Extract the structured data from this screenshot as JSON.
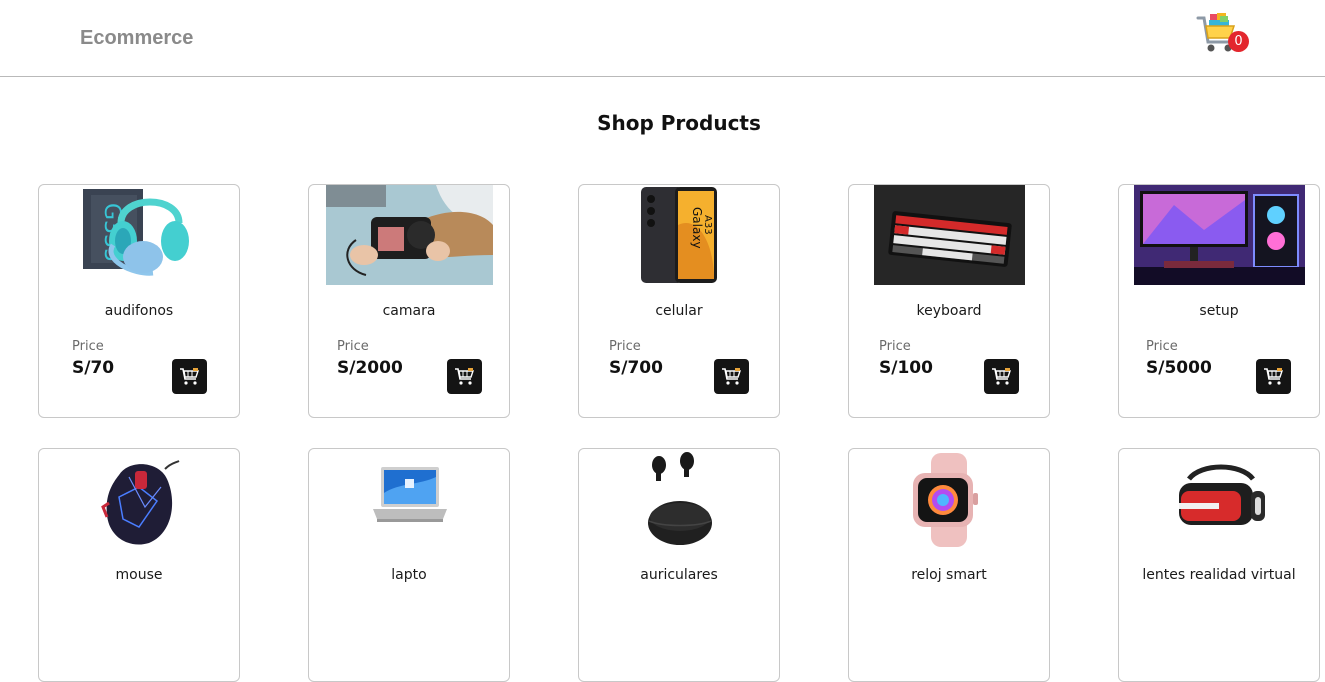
{
  "header": {
    "brand": "Ecommerce",
    "cart_count": "0",
    "cart_icon": "shopping-cart-icon"
  },
  "page_title": "Shop Products",
  "price_label": "Price",
  "products": [
    {
      "name": "audifonos",
      "price": "S/70"
    },
    {
      "name": "camara",
      "price": "S/2000"
    },
    {
      "name": "celular",
      "price": "S/700"
    },
    {
      "name": "keyboard",
      "price": "S/100"
    },
    {
      "name": "setup",
      "price": "S/5000"
    },
    {
      "name": "mouse"
    },
    {
      "name": "lapto"
    },
    {
      "name": "auriculares"
    },
    {
      "name": "reloj smart"
    },
    {
      "name": "lentes realidad virtual"
    }
  ],
  "colors": {
    "brand_text": "#8a8a8a",
    "badge": "#e3262d",
    "add_button": "#141414"
  }
}
